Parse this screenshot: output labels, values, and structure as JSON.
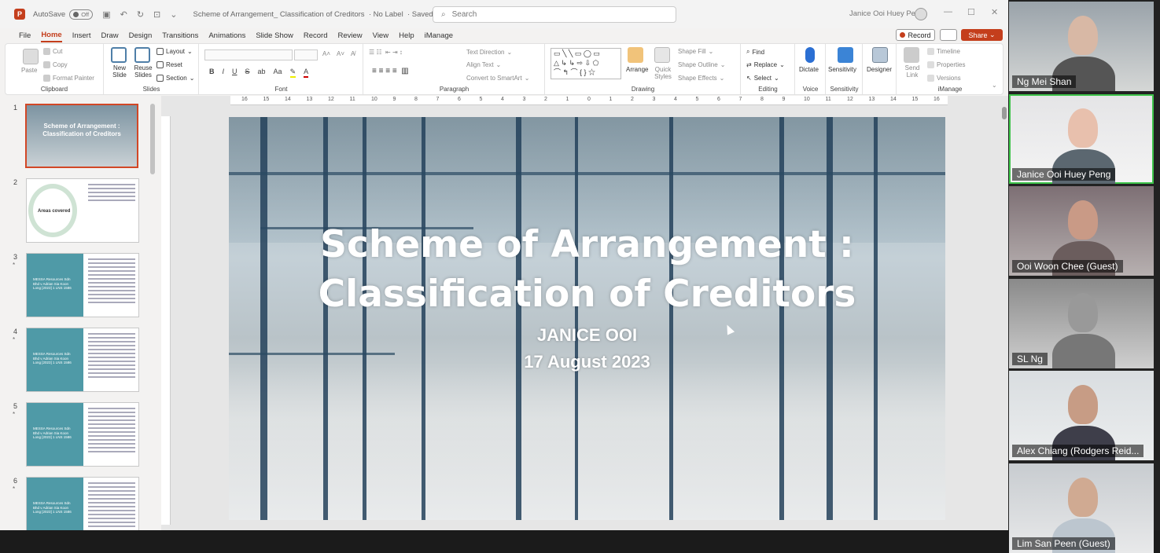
{
  "titlebar": {
    "autosave_label": "AutoSave",
    "autosave_state": "Off",
    "doc_title": "Scheme of Arrangement_ Classification of Creditors",
    "label_status": "No Label",
    "save_status": "Saved to this PC",
    "search_placeholder": "Search",
    "user_name": "Janice Ooi Huey Peng"
  },
  "menu": {
    "items": [
      "File",
      "Home",
      "Insert",
      "Draw",
      "Design",
      "Transitions",
      "Animations",
      "Slide Show",
      "Record",
      "Review",
      "View",
      "Help",
      "iManage"
    ],
    "active": "Home",
    "record_button": "Record",
    "share_button": "Share"
  },
  "ribbon": {
    "clipboard": {
      "label": "Clipboard",
      "paste": "Paste",
      "cut": "Cut",
      "copy": "Copy",
      "format_painter": "Format Painter"
    },
    "slides": {
      "label": "Slides",
      "new_slide": "New Slide",
      "reuse_slides": "Reuse Slides",
      "layout": "Layout",
      "reset": "Reset",
      "section": "Section"
    },
    "font": {
      "label": "Font"
    },
    "paragraph": {
      "label": "Paragraph",
      "text_direction": "Text Direction",
      "align_text": "Align Text",
      "convert_smartart": "Convert to SmartArt"
    },
    "drawing": {
      "label": "Drawing",
      "arrange": "Arrange",
      "quick_styles": "Quick Styles",
      "shape_fill": "Shape Fill",
      "shape_outline": "Shape Outline",
      "shape_effects": "Shape Effects"
    },
    "editing": {
      "label": "Editing",
      "find": "Find",
      "replace": "Replace",
      "select": "Select"
    },
    "voice": {
      "label": "Voice",
      "dictate": "Dictate"
    },
    "sensitivity": {
      "label": "Sensitivity",
      "sensitivity": "Sensitivity"
    },
    "designer": {
      "designer": "Designer"
    },
    "imanage": {
      "label": "iManage",
      "send_link": "Send Link",
      "timeline": "Timeline",
      "properties": "Properties",
      "versions": "Versions"
    }
  },
  "ruler": {
    "ticks": [
      "16",
      "15",
      "14",
      "13",
      "12",
      "11",
      "10",
      "9",
      "8",
      "7",
      "6",
      "5",
      "4",
      "3",
      "2",
      "1",
      "0",
      "1",
      "2",
      "3",
      "4",
      "5",
      "6",
      "7",
      "8",
      "9",
      "10",
      "11",
      "12",
      "13",
      "14",
      "15",
      "16"
    ]
  },
  "thumbnails": [
    {
      "num": "1",
      "title": "Scheme of Arrangement : Classification of Creditors"
    },
    {
      "num": "2",
      "title": "Areas covered"
    },
    {
      "num": "3",
      "star": "*",
      "title": "MESSA Resources Sdn Bhd v Adrian Sia Koon Long [2023] 1 LNS 1586"
    },
    {
      "num": "4",
      "star": "*",
      "title": "MESSA Resources Sdn Bhd v Adrian Sia Koon Long [2023] 1 LNS 1586"
    },
    {
      "num": "5",
      "star": "*",
      "title": "MESSA Resources Sdn Bhd v Adrian Sia Koon Long [2023] 1 LNS 1586"
    },
    {
      "num": "6",
      "star": "*",
      "title": "MESSA Resources Sdn Bhd v Adrian Sia Koon Long [2023] 1 LNS 1586"
    }
  ],
  "slide": {
    "title_line1": "Scheme of Arrangement :",
    "title_line2": "Classification of Creditors",
    "presenter": "JANICE OOI",
    "date": "17 August 2023"
  },
  "participants": [
    {
      "name": "Ng Mei Shan"
    },
    {
      "name": "Janice Ooi Huey Peng",
      "speaking": true
    },
    {
      "name": "Ooi Woon Chee (Guest)"
    },
    {
      "name": "SL Ng"
    },
    {
      "name": "Alex Chiang (Rodgers Reid..."
    },
    {
      "name": "Lim San Peen (Guest)"
    }
  ],
  "colors": {
    "accent": "#c43e1c",
    "teal": "#4f9aa7",
    "speaking": "#3ec44a"
  }
}
